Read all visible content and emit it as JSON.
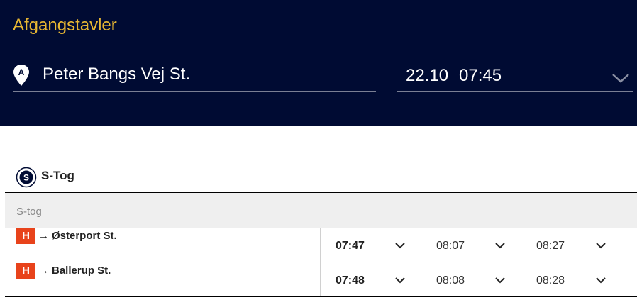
{
  "header": {
    "title": "Afgangstavler",
    "station": "Peter Bangs Vej St.",
    "date": "22.10",
    "time": "07:45"
  },
  "section": {
    "label": "S-Tog",
    "sublabel": "S-tog"
  },
  "departures": [
    {
      "badge": "H",
      "arrow": "→",
      "destination": "Østerport St.",
      "times": [
        "07:47",
        "08:07",
        "08:27"
      ]
    },
    {
      "badge": "H",
      "arrow": "→",
      "destination": "Ballerup St.",
      "times": [
        "07:48",
        "08:08",
        "08:28"
      ]
    }
  ],
  "colors": {
    "header_bg": "#000b33",
    "title": "#e8b733",
    "badge_h": "#e8431b"
  }
}
